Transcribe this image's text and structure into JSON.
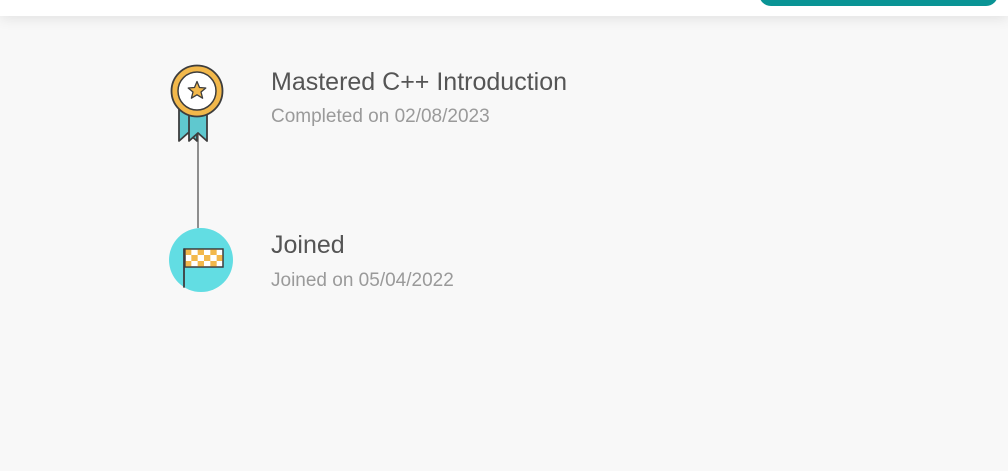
{
  "colors": {
    "accent": "#0a9495",
    "background": "#f8f8f8",
    "title_text": "#555555",
    "subtitle_text": "#9a9a9a",
    "medal_gold": "#f2b84b",
    "ribbon_teal": "#5fc8cf",
    "flag_circle": "#62dde3",
    "flag_orange": "#f2b84b"
  },
  "timeline": {
    "entries": [
      {
        "icon": "medal-icon",
        "title": "Mastered C++ Introduction",
        "subtitle": "Completed on 02/08/2023"
      },
      {
        "icon": "checkered-flag-icon",
        "title": "Joined",
        "subtitle": "Joined on 05/04/2022"
      }
    ]
  }
}
